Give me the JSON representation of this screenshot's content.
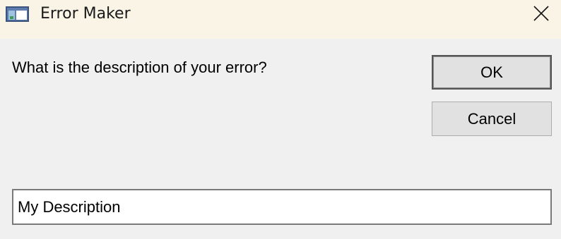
{
  "window": {
    "title": "Error Maker",
    "app_icon": "window-app-icon",
    "close_icon": "close-icon"
  },
  "dialog": {
    "prompt": "What is the description of your error?",
    "ok_label": "OK",
    "cancel_label": "Cancel",
    "description_value": "My Description"
  },
  "colors": {
    "titlebar_bg": "#f9f4e6",
    "dialog_bg": "#f0f0f0",
    "button_bg": "#e1e1e1"
  }
}
